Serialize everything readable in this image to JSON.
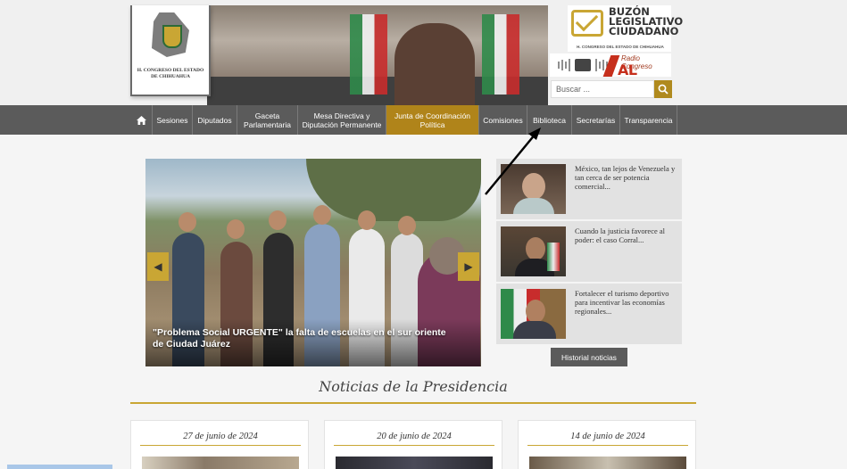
{
  "header": {
    "logo_text": "H. CONGRESO DEL ESTADO DE CHIHUAHUA",
    "banner_caption": "H. CONGRESO DEL ESTADO",
    "buzon_title_line1": "BUZÓN",
    "buzon_title_line2": "LEGISLATIVO",
    "buzon_title_line3": "CIUDADANO",
    "buzon_subtitle": "H. CONGRESO DEL ESTADO DE CHIHUAHUA",
    "radio_label": "Radio Congreso",
    "radio_big": "AL AIRE",
    "search_placeholder": "Buscar ..."
  },
  "nav": {
    "home_icon": "home-icon",
    "items": [
      {
        "label": "Sesiones"
      },
      {
        "label": "Diputados"
      },
      {
        "label": "Gaceta Parlamentaria"
      },
      {
        "label": "Mesa Directiva y Diputación Permanente"
      },
      {
        "label": "Junta de Coordinación Política"
      },
      {
        "label": "Comisiones"
      },
      {
        "label": "Biblioteca"
      },
      {
        "label": "Secretarías"
      },
      {
        "label": "Transparencia"
      }
    ]
  },
  "carousel": {
    "caption": "\"Problema Social URGENTE\" la falta de escuelas en el sur oriente de Ciudad Juárez",
    "prev_icon": "chevron-left-icon",
    "next_icon": "chevron-right-icon"
  },
  "news": [
    {
      "text": "México, tan lejos de Venezuela y tan cerca de ser potencia comercial..."
    },
    {
      "text": "Cuando la justicia favorece al poder: el caso Corral..."
    },
    {
      "text": "Fortalecer el turismo deportivo para incentivar las economías regionales..."
    }
  ],
  "historial_label": "Historial noticias",
  "presidencia": {
    "title": "Noticias de la Presidencia",
    "cards": [
      {
        "date": "27 de junio de 2024"
      },
      {
        "date": "20 de junio de 2024"
      },
      {
        "date": "14 de junio de 2024"
      }
    ]
  },
  "colors": {
    "nav_bg": "#5b5b5b",
    "accent_gold": "#b0841a",
    "radio_red": "#c62f1c"
  }
}
